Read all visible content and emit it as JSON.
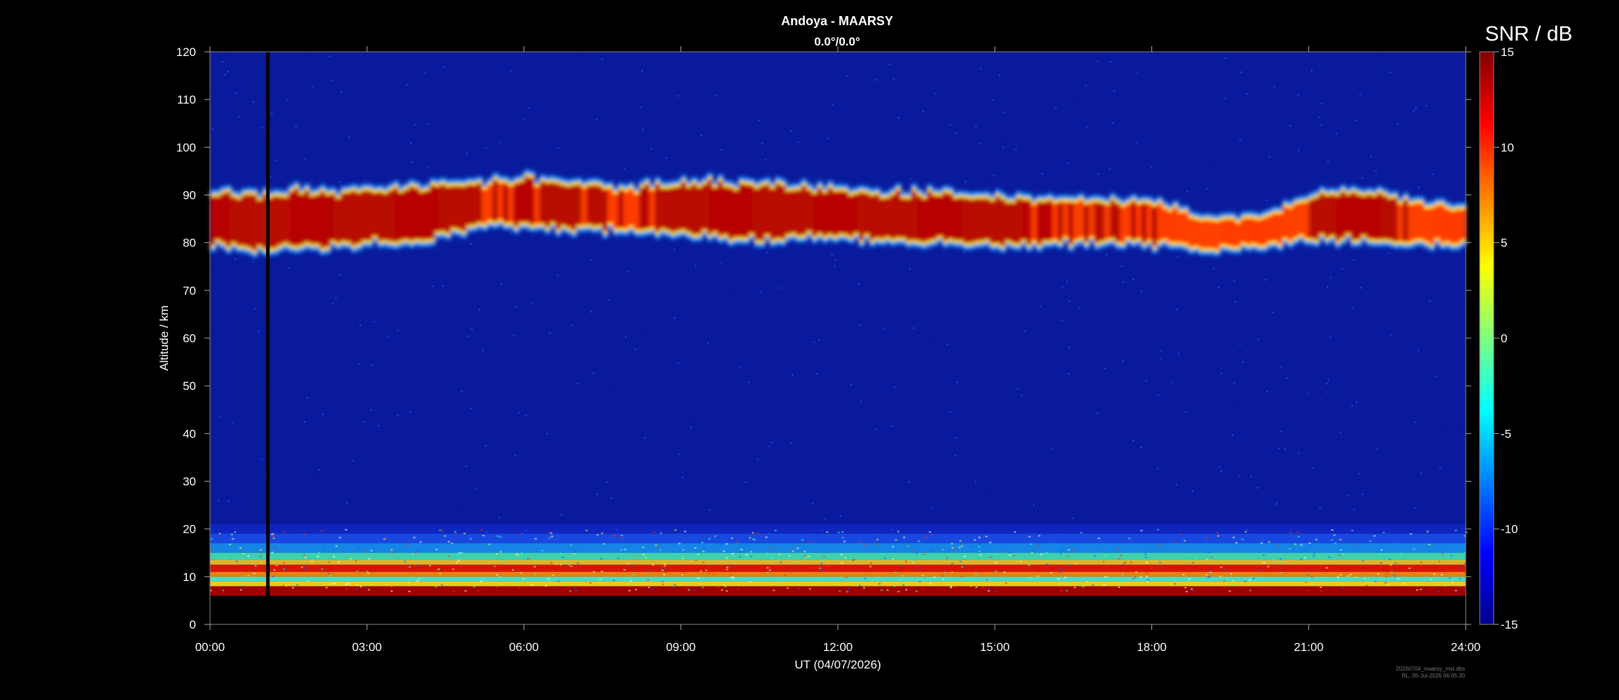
{
  "chart_data": {
    "type": "heatmap",
    "title": "Andoya - MAARSY",
    "subtitle": "0.0°/0.0°",
    "xlabel": "UT (04/07/2026)",
    "ylabel": "Altitude / km",
    "xlim": [
      0,
      24
    ],
    "ylim": [
      0,
      120
    ],
    "x_ticks": [
      "00:00",
      "03:00",
      "06:00",
      "09:00",
      "12:00",
      "15:00",
      "18:00",
      "21:00",
      "24:00"
    ],
    "y_ticks": [
      "0",
      "10",
      "20",
      "30",
      "40",
      "50",
      "60",
      "70",
      "80",
      "90",
      "100",
      "110",
      "120"
    ],
    "colorbar": {
      "label": "SNR / dB",
      "range": [
        -15,
        15
      ],
      "ticks": [
        "15",
        "10",
        "5",
        "0",
        "-5",
        "-10",
        "-15"
      ]
    },
    "data_gap_hours": 1.1,
    "data_bottom_km": 6,
    "pmse_layer": {
      "hours": [
        0,
        1,
        2,
        3,
        4,
        5,
        6,
        7,
        8,
        9,
        10,
        11,
        12,
        13,
        14,
        15,
        16,
        17,
        18,
        19,
        20,
        21,
        22,
        23,
        24
      ],
      "center_km": [
        85,
        84.5,
        85,
        85.5,
        86,
        88,
        88.5,
        87.5,
        87,
        87.5,
        86.5,
        86.5,
        86,
        85.5,
        85,
        84.5,
        84.5,
        84.5,
        84,
        82,
        82,
        85.5,
        85.5,
        84,
        83.5
      ],
      "strength": [
        0.9,
        0.9,
        0.95,
        0.9,
        0.9,
        0.6,
        0.7,
        0.65,
        0.6,
        0.85,
        0.95,
        0.85,
        0.7,
        0.75,
        0.8,
        0.75,
        0.6,
        0.6,
        0.55,
        0.3,
        0.25,
        0.6,
        0.75,
        0.6,
        0.4
      ]
    },
    "footnote": [
      "20260704_maarsy_mst.dbs",
      "RL, 05-Jul-2026 06:05:30"
    ]
  }
}
